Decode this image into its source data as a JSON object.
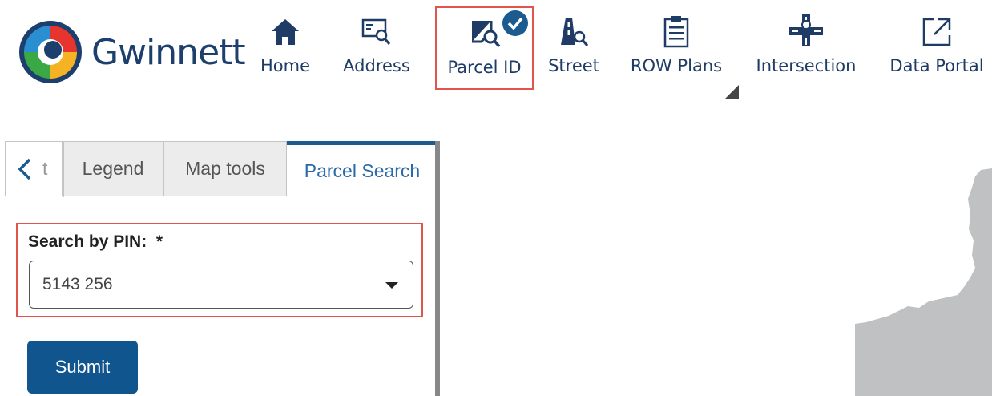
{
  "brand": {
    "name": "Gwinnett"
  },
  "nav": {
    "items": [
      {
        "label": "Home",
        "icon": "home-icon"
      },
      {
        "label": "Address",
        "icon": "address-search-icon"
      },
      {
        "label": "Parcel ID",
        "icon": "parcel-search-icon",
        "active": true
      },
      {
        "label": "Street",
        "icon": "street-search-icon"
      },
      {
        "label": "ROW Plans",
        "icon": "row-plans-icon"
      },
      {
        "label": "Intersection",
        "icon": "intersection-icon"
      },
      {
        "label": "Data Portal",
        "icon": "external-link-icon"
      }
    ]
  },
  "panel": {
    "tabs": [
      {
        "label": "t"
      },
      {
        "label": "Legend"
      },
      {
        "label": "Map tools"
      },
      {
        "label": "Parcel Search",
        "active": true
      }
    ],
    "search": {
      "label": "Search by PIN:",
      "required_mark": "*",
      "value": "5143 256"
    },
    "submit_label": "Submit"
  },
  "colors": {
    "brand_navy": "#1c3f6e",
    "accent_blue": "#11558f",
    "highlight_red": "#e2554a",
    "map_gray": "#bfc1c3"
  }
}
